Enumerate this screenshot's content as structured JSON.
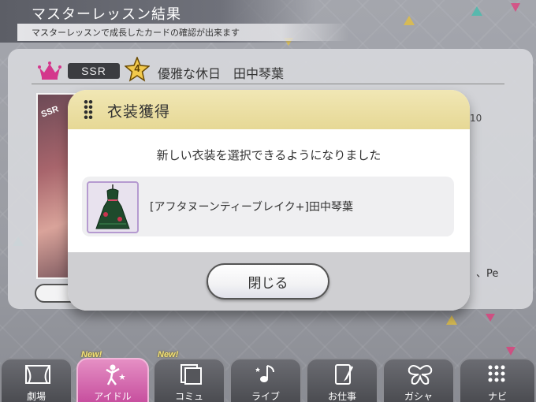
{
  "header": {
    "title": "マスターレッスン結果",
    "subtitle": "マスターレッスンで成長したカードの確認が出来ます"
  },
  "card": {
    "rarity": "SSR",
    "star_level": "4",
    "name": "優雅な休日　田中琴葉",
    "peek_value": "10",
    "peek_text": "、Pe"
  },
  "modal": {
    "title": "衣装獲得",
    "message": "新しい衣装を選択できるようになりました",
    "item_name": "[アフタヌーンティーブレイク+]田中琴葉",
    "close_label": "閉じる"
  },
  "nav": {
    "new_badge": "New!",
    "tabs": [
      {
        "label": "劇場",
        "icon": "theater-icon"
      },
      {
        "label": "アイドル",
        "icon": "idol-icon",
        "active": true,
        "new": true
      },
      {
        "label": "コミュ",
        "icon": "commu-icon",
        "new": true
      },
      {
        "label": "ライブ",
        "icon": "live-icon"
      },
      {
        "label": "お仕事",
        "icon": "work-icon"
      },
      {
        "label": "ガシャ",
        "icon": "gacha-icon"
      },
      {
        "label": "ナビ",
        "icon": "navi-icon"
      }
    ]
  },
  "colors": {
    "modal_header": "#e9dc9c",
    "active_tab": "#d565aa",
    "crown": "#d4378c"
  }
}
